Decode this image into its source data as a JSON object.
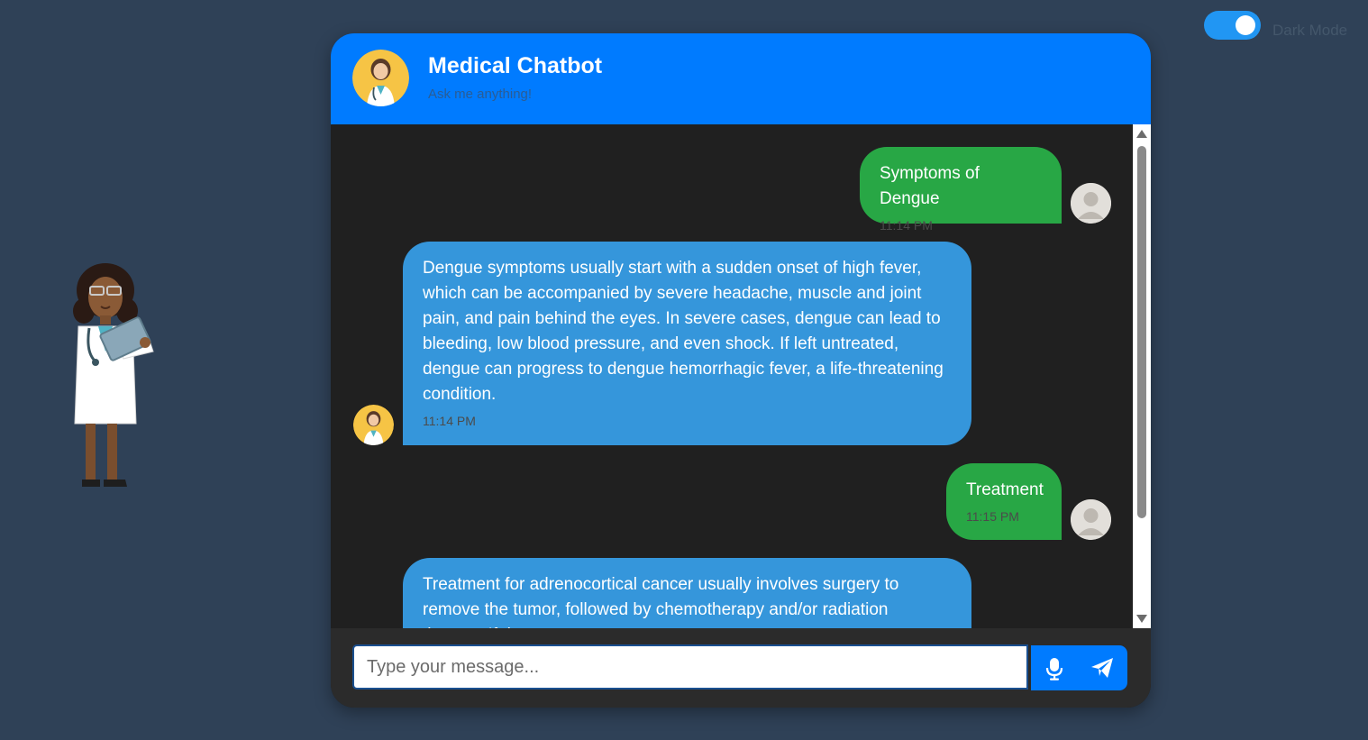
{
  "toggle": {
    "label": "Dark Mode",
    "on": true
  },
  "header": {
    "title": "Medical Chatbot",
    "subtitle": "Ask me anything!"
  },
  "messages": [
    {
      "sender": "user",
      "text": "Symptoms of Dengue",
      "time": "11:14 PM"
    },
    {
      "sender": "bot",
      "text": "Dengue symptoms usually start with a sudden onset of high fever, which can be accompanied by severe headache, muscle and joint pain, and pain behind the eyes. In severe cases, dengue can lead to bleeding, low blood pressure, and even shock. If left untreated, dengue can progress to dengue hemorrhagic fever, a life-threatening condition.",
      "time": "11:14 PM"
    },
    {
      "sender": "user",
      "text": "Treatment",
      "time": "11:15 PM"
    },
    {
      "sender": "bot",
      "text": "Treatment for adrenocortical cancer usually involves surgery to remove the tumor, followed by chemotherapy and/or radiation therapy. If the"
    }
  ],
  "input": {
    "placeholder": "Type your message...",
    "value": ""
  },
  "icons": {
    "mic": "microphone-icon",
    "send": "paper-plane-icon"
  },
  "colors": {
    "header": "#007bff",
    "user_bubble": "#28a745",
    "bot_bubble": "#3596db",
    "background": "#2f4157",
    "chat_bg": "#202020"
  }
}
